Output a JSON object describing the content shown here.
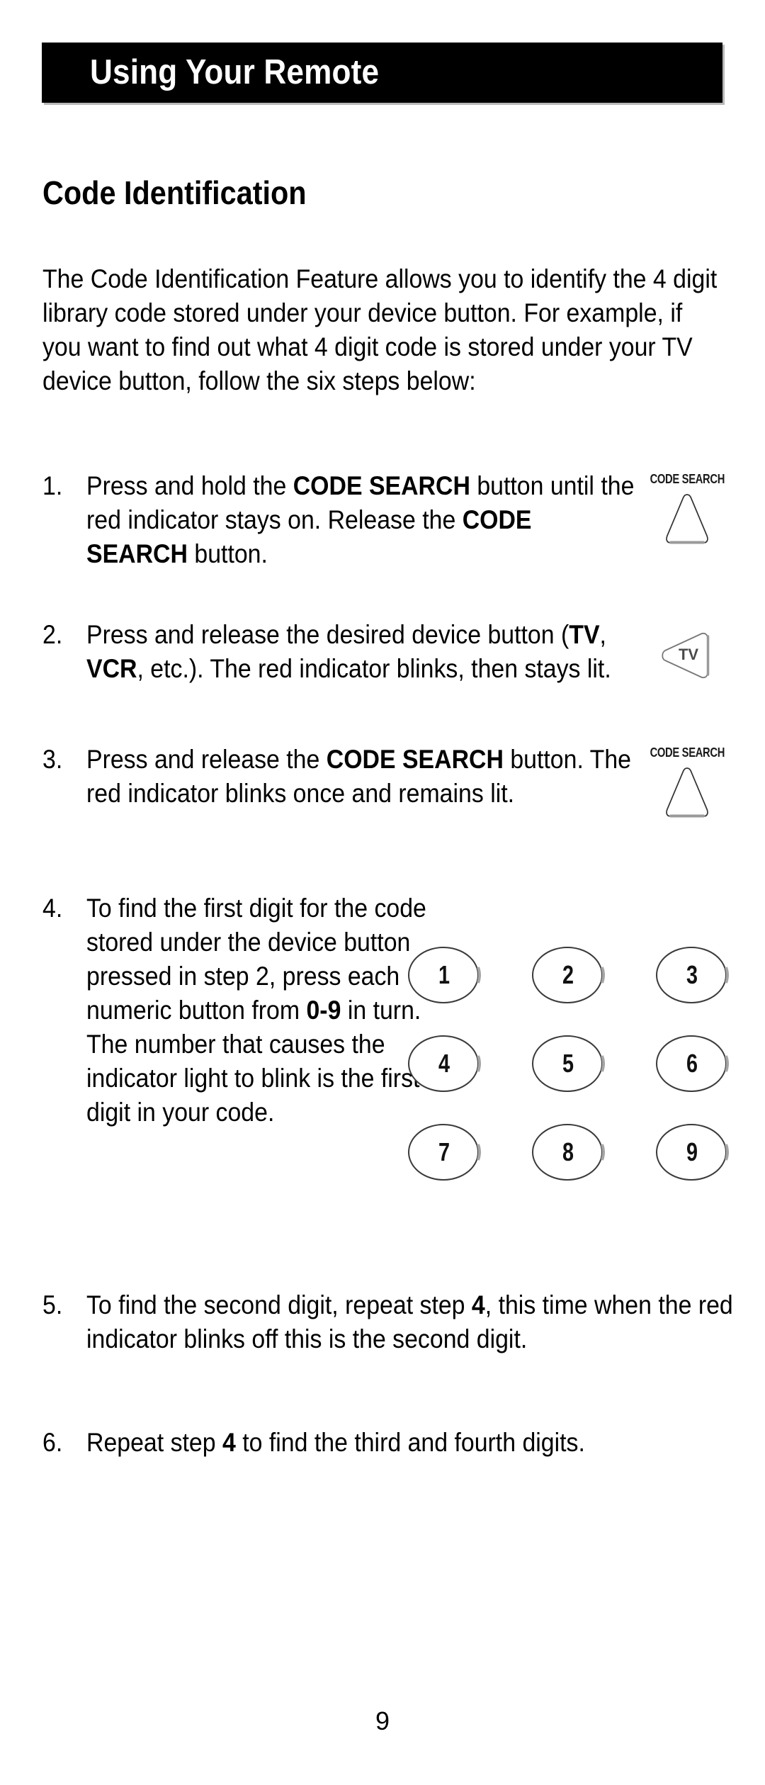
{
  "page": {
    "banner_title": "Using Your Remote",
    "section_heading": "Code Identification",
    "page_number": "9",
    "colors": {
      "banner_background": "#000000",
      "banner_text": "#ffffff",
      "body_text": "#000000",
      "banner_shadow": "#b8b8b8",
      "key_outline": "#3a3a3a"
    }
  },
  "intro": {
    "paragraph": "The Code Identification Feature allows you to identify the 4 digit library code stored under your device button. For example, if you want to find out what 4 digit code is stored under your TV device button, follow the six steps below:"
  },
  "steps": [
    {
      "marker": "1.",
      "parts": [
        {
          "text": "Press and hold the ",
          "bold": false
        },
        {
          "text": "CODE SEARCH",
          "bold": true
        },
        {
          "text": " button until the red indicator stays on. Release the ",
          "bold": false
        },
        {
          "text": "CODE SEARCH",
          "bold": true
        },
        {
          "text": " button.",
          "bold": false
        }
      ]
    },
    {
      "marker": "2.",
      "parts": [
        {
          "text": "Press and release the desired device button (",
          "bold": false
        },
        {
          "text": "TV",
          "bold": true
        },
        {
          "text": ", ",
          "bold": false
        },
        {
          "text": "VCR",
          "bold": true
        },
        {
          "text": ", etc.). The red indicator blinks, then stays lit.",
          "bold": false
        }
      ]
    },
    {
      "marker": "3.",
      "parts": [
        {
          "text": "Press and release the ",
          "bold": false
        },
        {
          "text": "CODE SEARCH",
          "bold": true
        },
        {
          "text": " button. The red indicator blinks once and remains lit.",
          "bold": false
        }
      ]
    },
    {
      "marker": "4.",
      "parts": [
        {
          "text": "To find the first digit for the code stored under the device button pressed in step 2, press each numeric button from ",
          "bold": false
        },
        {
          "text": "0-9",
          "bold": true
        },
        {
          "text": " in turn. The number that causes the indicator light to blink is the first digit in your code.",
          "bold": false
        }
      ]
    },
    {
      "marker": "5.",
      "parts": [
        {
          "text": "To find the second digit, repeat step ",
          "bold": false
        },
        {
          "text": "4",
          "bold": true
        },
        {
          "text": ", this time when the red indicator blinks off this is the second digit.",
          "bold": false
        }
      ]
    },
    {
      "marker": "6.",
      "parts": [
        {
          "text": "Repeat step ",
          "bold": false
        },
        {
          "text": "4",
          "bold": true
        },
        {
          "text": " to find the third and fourth digits.",
          "bold": false
        }
      ]
    }
  ],
  "key_art": {
    "code_search_label": "CODE SEARCH",
    "tv_label": "TV"
  },
  "keypad": {
    "rows": [
      [
        "1",
        "2",
        "3"
      ],
      [
        "4",
        "5",
        "6"
      ],
      [
        "7",
        "8",
        "9"
      ]
    ]
  }
}
